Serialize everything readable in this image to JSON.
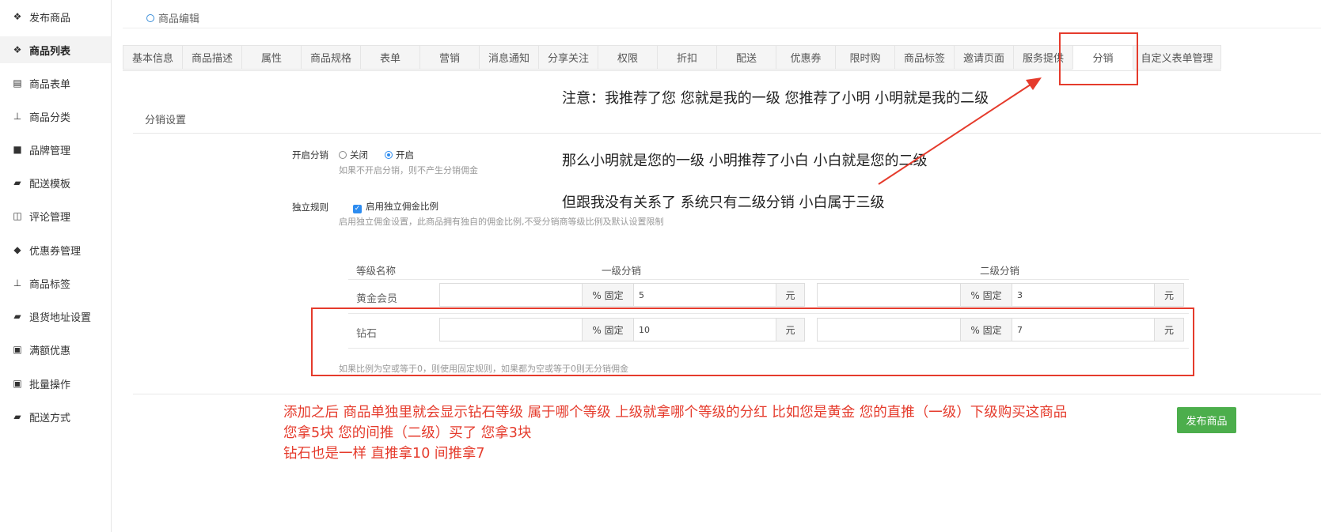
{
  "sidebar": {
    "items": [
      {
        "label": "发布商品",
        "icon": "cubes-icon"
      },
      {
        "label": "商品列表",
        "icon": "cubes-icon"
      },
      {
        "label": "商品表单",
        "icon": "file-excel-icon"
      },
      {
        "label": "商品分类",
        "icon": "sitemap-icon"
      },
      {
        "label": "品牌管理",
        "icon": "briefcase-icon"
      },
      {
        "label": "配送模板",
        "icon": "truck-icon"
      },
      {
        "label": "评论管理",
        "icon": "columns-icon"
      },
      {
        "label": "优惠券管理",
        "icon": "tags-icon"
      },
      {
        "label": "商品标签",
        "icon": "sitemap-icon"
      },
      {
        "label": "退货地址设置",
        "icon": "truck-icon"
      },
      {
        "label": "满额优惠",
        "icon": "gift-icon"
      },
      {
        "label": "批量操作",
        "icon": "gift-icon"
      },
      {
        "label": "配送方式",
        "icon": "truck-icon"
      }
    ],
    "active_index": 1
  },
  "breadcrumb": "商品编辑",
  "tabs": [
    "基本信息",
    "商品描述",
    "属性",
    "商品规格",
    "表单",
    "营销",
    "消息通知",
    "分享关注",
    "权限",
    "折扣",
    "配送",
    "优惠券",
    "限时购",
    "商品标签",
    "邀请页面",
    "服务提供",
    "分销",
    "自定义表单管理"
  ],
  "active_tab": "分销",
  "section_title": "分销设置",
  "form": {
    "enable_label": "开启分销",
    "radio_off": "关闭",
    "radio_on": "开启",
    "enable_hint": "如果不开启分销，则不产生分销佣金",
    "rule_label": "独立规则",
    "rule_checkbox": "启用独立佣金比例",
    "rule_hint": "启用独立佣金设置，此商品拥有独自的佣金比例,不受分销商等级比例及默认设置限制"
  },
  "table": {
    "headers": {
      "name": "等级名称",
      "level1": "一级分销",
      "level2": "二级分销"
    },
    "addon_percent": "% 固定",
    "addon_unit": "元",
    "rows": [
      {
        "name": "黄金会员",
        "l1_percent": "",
        "l1_fixed": "5",
        "l2_percent": "",
        "l2_fixed": "3"
      },
      {
        "name": "钻石",
        "l1_percent": "",
        "l1_fixed": "10",
        "l2_percent": "",
        "l2_fixed": "7"
      }
    ],
    "footer_hint": "如果比例为空或等于0，则使用固定规则，如果都为空或等于0则无分销佣金"
  },
  "notes_black": [
    "注意：我推荐了您  您就是我的一级   您推荐了小明  小明就是我的二级",
    "那么小明就是您的一级    小明推荐了小白   小白就是您的二级",
    "但跟我没有关系了  系统只有二级分销   小白属于三级"
  ],
  "notes_red": [
    "添加之后  商品单独里就会显示钻石等级   属于哪个等级 上级就拿哪个等级的分红  比如您是黄金 您的直推（一级）下级购买这商品",
    "您拿5块  您的间推（二级）买了 您拿3块",
    "钻石也是一样  直推拿10  间推拿7"
  ],
  "publish_button": "发布商品",
  "colors": {
    "annotation_red": "#e53b2c",
    "primary_blue": "#2d8cf0",
    "publish_green": "#4cae4c"
  }
}
